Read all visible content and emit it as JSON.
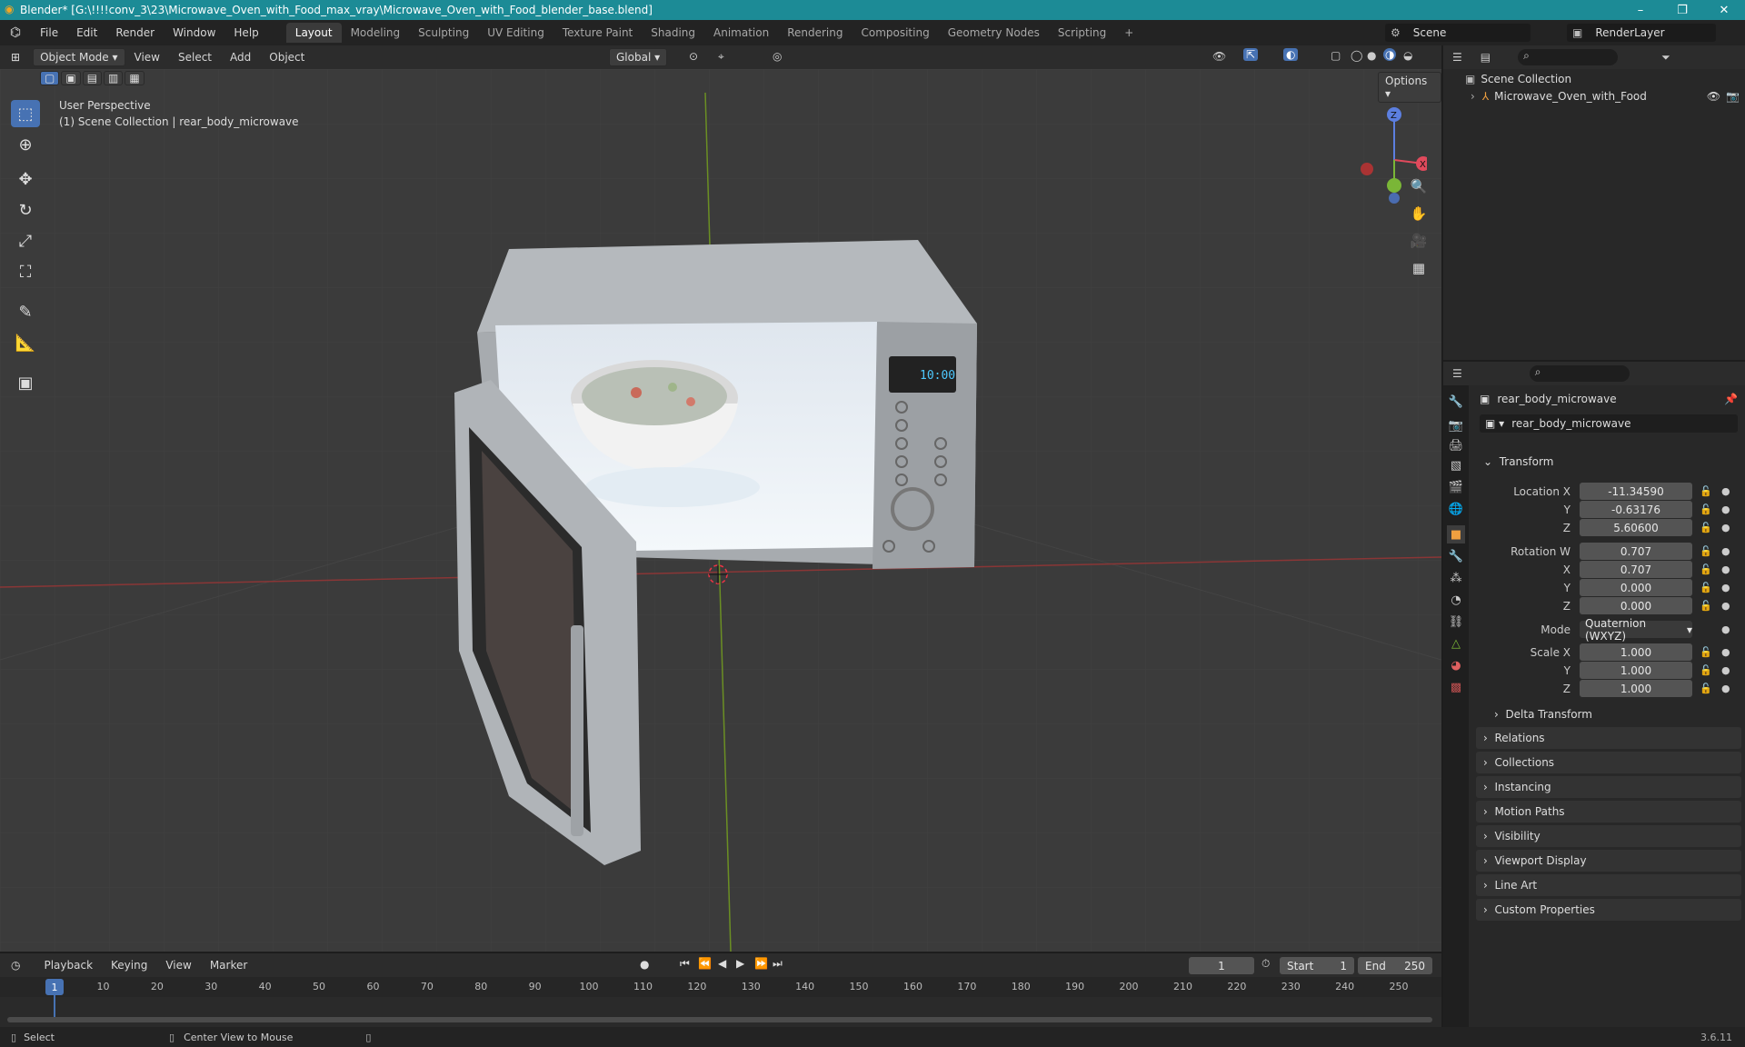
{
  "window": {
    "title": "Blender* [G:\\!!!!conv_3\\23\\Microwave_Oven_with_Food_max_vray\\Microwave_Oven_with_Food_blender_base.blend]",
    "minimize": "–",
    "restore": "❐",
    "close": "✕"
  },
  "menu": [
    "File",
    "Edit",
    "Render",
    "Window",
    "Help"
  ],
  "workspaces": [
    "Layout",
    "Modeling",
    "Sculpting",
    "UV Editing",
    "Texture Paint",
    "Shading",
    "Animation",
    "Rendering",
    "Compositing",
    "Geometry Nodes",
    "Scripting"
  ],
  "workspace_add": "+",
  "scene": {
    "name": "Scene",
    "render_layer": "RenderLayer"
  },
  "viewport": {
    "mode": "Object Mode",
    "menus": [
      "View",
      "Select",
      "Add",
      "Object"
    ],
    "transform_orientation": "Global",
    "options_label": "Options",
    "perspective": "User Perspective",
    "collection_info": "(1) Scene Collection | rear_body_microwave",
    "display_time": "10:00",
    "gizmo": {
      "x": "X",
      "y": "Y",
      "z": "Z"
    }
  },
  "outliner": {
    "root": "Scene Collection",
    "items": [
      {
        "name": "Microwave_Oven_with_Food"
      }
    ]
  },
  "properties": {
    "object_name": "rear_body_microwave",
    "data_name": "rear_body_microwave",
    "transform": {
      "title": "Transform",
      "location": {
        "label": "Location X",
        "x": "-11.34590",
        "y": "-0.63176",
        "z": "5.60600"
      },
      "rotation": {
        "label": "Rotation W",
        "w": "0.707",
        "x": "0.707",
        "y": "0.000",
        "z": "0.000"
      },
      "mode_label": "Mode",
      "mode": "Quaternion (WXYZ)",
      "scale": {
        "label": "Scale X",
        "x": "1.000",
        "y": "1.000",
        "z": "1.000"
      },
      "axis_y": "Y",
      "axis_z": "Z",
      "axis_x": "X",
      "delta": "Delta Transform"
    },
    "sections": [
      "Relations",
      "Collections",
      "Instancing",
      "Motion Paths",
      "Visibility",
      "Viewport Display",
      "Line Art",
      "Custom Properties"
    ]
  },
  "timeline": {
    "menus": [
      "Playback",
      "Keying",
      "View",
      "Marker"
    ],
    "current_frame": "1",
    "start_label": "Start",
    "start": "1",
    "end_label": "End",
    "end": "250",
    "ticks": [
      "1",
      "10",
      "20",
      "30",
      "40",
      "50",
      "60",
      "70",
      "80",
      "90",
      "100",
      "110",
      "120",
      "130",
      "140",
      "150",
      "160",
      "170",
      "180",
      "190",
      "200",
      "210",
      "220",
      "230",
      "240",
      "250"
    ]
  },
  "status": {
    "left": "Select",
    "middle": "Center View to Mouse",
    "version": "3.6.11"
  }
}
